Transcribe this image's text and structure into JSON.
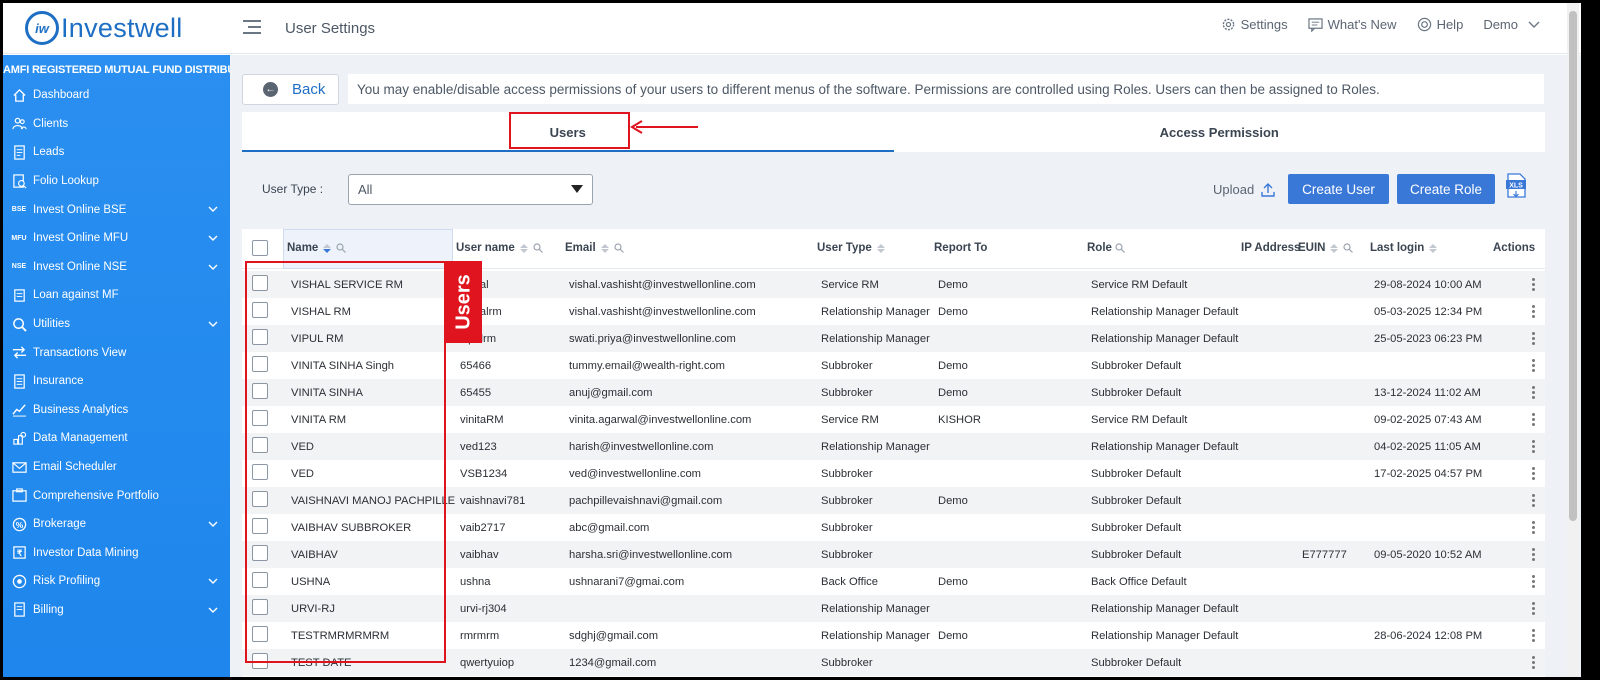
{
  "brand": {
    "logo_mark": "iw",
    "logo_text": "Investwell"
  },
  "header": {
    "page_title": "User Settings",
    "links": [
      {
        "label": "Settings",
        "icon": "gear-icon"
      },
      {
        "label": "What's New",
        "icon": "news-icon"
      },
      {
        "label": "Help",
        "icon": "help-icon"
      }
    ],
    "user": "Demo"
  },
  "sidebar": {
    "tagline": "AMFI REGISTERED MUTUAL FUND DISTRIBUTOR",
    "items": [
      {
        "label": "Dashboard",
        "icon": "home-icon",
        "expandable": false
      },
      {
        "label": "Clients",
        "icon": "clients-icon",
        "expandable": false
      },
      {
        "label": "Leads",
        "icon": "leads-icon",
        "expandable": false
      },
      {
        "label": "Folio Lookup",
        "icon": "folio-icon",
        "expandable": false
      },
      {
        "label": "Invest Online BSE",
        "icon": "bse-icon",
        "icon_text": "BSE",
        "expandable": true
      },
      {
        "label": "Invest Online MFU",
        "icon": "mfu-icon",
        "icon_text": "MFU",
        "expandable": true
      },
      {
        "label": "Invest Online NSE",
        "icon": "nse-icon",
        "icon_text": "NSE",
        "expandable": true
      },
      {
        "label": "Loan against MF",
        "icon": "loan-icon",
        "expandable": false
      },
      {
        "label": "Utilities",
        "icon": "utilities-icon",
        "expandable": true
      },
      {
        "label": "Transactions View",
        "icon": "transactions-icon",
        "expandable": false
      },
      {
        "label": "Insurance",
        "icon": "insurance-icon",
        "expandable": false
      },
      {
        "label": "Business Analytics",
        "icon": "analytics-icon",
        "expandable": false
      },
      {
        "label": "Data Management",
        "icon": "data-icon",
        "expandable": false
      },
      {
        "label": "Email Scheduler",
        "icon": "email-icon",
        "expandable": false
      },
      {
        "label": "Comprehensive Portfolio",
        "icon": "portfolio-icon",
        "expandable": false
      },
      {
        "label": "Brokerage",
        "icon": "brokerage-icon",
        "expandable": true
      },
      {
        "label": "Investor Data Mining",
        "icon": "mining-icon",
        "expandable": false
      },
      {
        "label": "Risk Profiling",
        "icon": "risk-icon",
        "expandable": true
      },
      {
        "label": "Billing",
        "icon": "billing-icon",
        "expandable": true
      }
    ]
  },
  "main": {
    "back_label": "Back",
    "notice": "You may enable/disable access permissions of your users to different menus of the software. Permissions are controlled using Roles. Users can then be assigned to Roles.",
    "tabs": [
      {
        "label": "Users",
        "active": true
      },
      {
        "label": "Access Permission",
        "active": false
      }
    ],
    "filter": {
      "label": "User Type :",
      "value": "All"
    },
    "upload_label": "Upload",
    "create_user_label": "Create User",
    "create_role_label": "Create Role",
    "xls_label": "XLS"
  },
  "table": {
    "columns": [
      "Name",
      "User name",
      "Email",
      "User Type",
      "Report To",
      "Role",
      "IP Address",
      "EUIN",
      "Last login",
      "Actions"
    ],
    "rows": [
      {
        "name": "VISHAL SERVICE RM",
        "username": "vishal",
        "email": "vishal.vashisht@investwellonline.com",
        "type": "Service RM",
        "report_to": "Demo",
        "role": "Service RM Default",
        "ip": "",
        "euin": "",
        "last_login": "29-08-2024 10:00 AM"
      },
      {
        "name": "VISHAL RM",
        "username": "vishalrm",
        "email": "vishal.vashisht@investwellonline.com",
        "type": "Relationship Manager",
        "report_to": "Demo",
        "role": "Relationship Manager Default",
        "ip": "",
        "euin": "",
        "last_login": "05-03-2025 12:34 PM"
      },
      {
        "name": "VIPUL RM",
        "username": "vipulrm",
        "email": "swati.priya@investwellonline.com",
        "type": "Relationship Manager",
        "report_to": "",
        "role": "Relationship Manager Default",
        "ip": "",
        "euin": "",
        "last_login": "25-05-2023 06:23 PM"
      },
      {
        "name": "VINITA SINHA Singh",
        "username": "65466",
        "email": "tummy.email@wealth-right.com",
        "type": "Subbroker",
        "report_to": "Demo",
        "role": "Subbroker Default",
        "ip": "",
        "euin": "",
        "last_login": ""
      },
      {
        "name": "VINITA SINHA",
        "username": "65455",
        "email": "anuj@gmail.com",
        "type": "Subbroker",
        "report_to": "Demo",
        "role": "Subbroker Default",
        "ip": "",
        "euin": "",
        "last_login": "13-12-2024 11:02 AM"
      },
      {
        "name": "VINITA RM",
        "username": "vinitaRM",
        "email": "vinita.agarwal@investwellonline.com",
        "type": "Service RM",
        "report_to": "KISHOR",
        "role": "Service RM Default",
        "ip": "",
        "euin": "",
        "last_login": "09-02-2025 07:43 AM"
      },
      {
        "name": "VED",
        "username": "ved123",
        "email": "harish@investwellonline.com",
        "type": "Relationship Manager",
        "report_to": "",
        "role": "Relationship Manager Default",
        "ip": "",
        "euin": "",
        "last_login": "04-02-2025 11:05 AM"
      },
      {
        "name": "VED",
        "username": "VSB1234",
        "email": "ved@investwellonline.com",
        "type": "Subbroker",
        "report_to": "",
        "role": "Subbroker Default",
        "ip": "",
        "euin": "",
        "last_login": "17-02-2025 04:57 PM"
      },
      {
        "name": "VAISHNAVI MANOJ PACHPILLE",
        "username": "vaishnavi781",
        "email": "pachpillevaishnavi@gmail.com",
        "type": "Subbroker",
        "report_to": "Demo",
        "role": "Subbroker Default",
        "ip": "",
        "euin": "",
        "last_login": ""
      },
      {
        "name": "VAIBHAV SUBBROKER",
        "username": "vaib2717",
        "email": "abc@gmail.com",
        "type": "Subbroker",
        "report_to": "",
        "role": "Subbroker Default",
        "ip": "",
        "euin": "",
        "last_login": ""
      },
      {
        "name": "VAIBHAV",
        "username": "vaibhav",
        "email": "harsha.sri@investwellonline.com",
        "type": "Subbroker",
        "report_to": "",
        "role": "Subbroker Default",
        "ip": "",
        "euin": "E777777",
        "last_login": "09-05-2020 10:52 AM"
      },
      {
        "name": "USHNA",
        "username": "ushna",
        "email": "ushnarani7@gmai.com",
        "type": "Back Office",
        "report_to": "Demo",
        "role": "Back Office Default",
        "ip": "",
        "euin": "",
        "last_login": ""
      },
      {
        "name": "URVI-RJ",
        "username": "urvi-rj304",
        "email": "",
        "type": "Relationship Manager",
        "report_to": "",
        "role": "Relationship Manager Default",
        "ip": "",
        "euin": "",
        "last_login": ""
      },
      {
        "name": "TESTRMRMRMRM",
        "username": "rmrmrm",
        "email": "sdghj@gmail.com",
        "type": "Relationship Manager",
        "report_to": "Demo",
        "role": "Relationship Manager Default",
        "ip": "",
        "euin": "",
        "last_login": "28-06-2024 12:08 PM"
      },
      {
        "name": "TEST DATE",
        "username": "qwertyuiop",
        "email": "1234@gmail.com",
        "type": "Subbroker",
        "report_to": "",
        "role": "Subbroker Default",
        "ip": "",
        "euin": "",
        "last_login": ""
      }
    ]
  },
  "annotation": {
    "users_label": "Users"
  },
  "colors": {
    "brand": "#1e6fc4",
    "sidebar": "#2a8ff0",
    "primary_button": "#3a78d8",
    "annotation": "#e0141e"
  }
}
